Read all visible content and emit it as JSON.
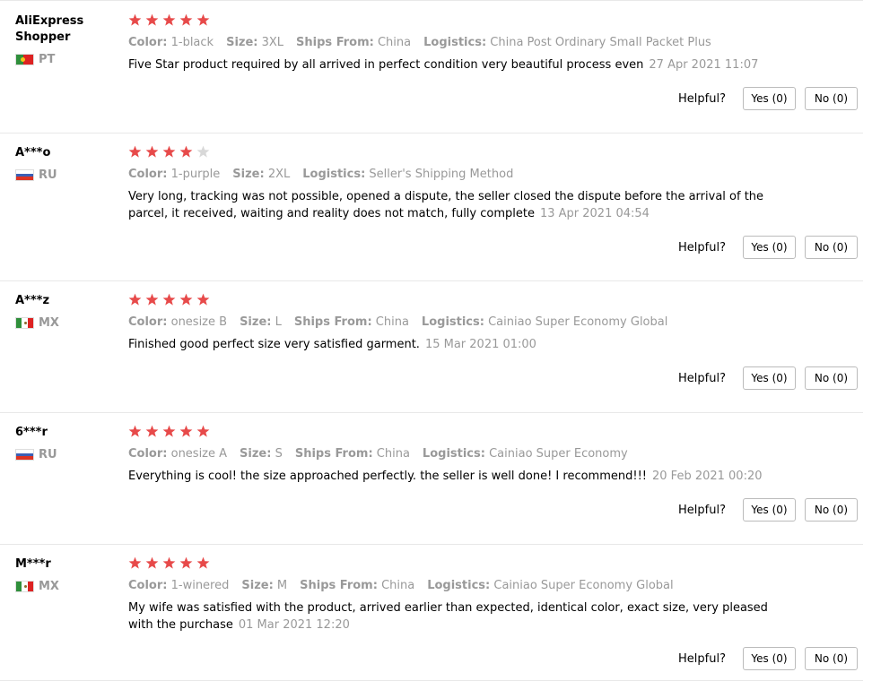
{
  "reviews": [
    {
      "user": "AliExpress Shopper",
      "country": "PT",
      "flag": "pt",
      "rating": 5,
      "attributes": [
        {
          "label": "Color:",
          "value": "1-black"
        },
        {
          "label": "Size:",
          "value": "3XL"
        },
        {
          "label": "Ships From:",
          "value": "China"
        },
        {
          "label": "Logistics:",
          "value": "China Post Ordinary Small Packet Plus"
        }
      ],
      "text": "Five Star product required by all arrived in perfect condition very beautiful process even",
      "date": "27 Apr 2021 11:07",
      "helpful_label": "Helpful?",
      "yes_label": "Yes (0)",
      "no_label": "No (0)"
    },
    {
      "user": "A***o",
      "country": "RU",
      "flag": "ru",
      "rating": 4,
      "attributes": [
        {
          "label": "Color:",
          "value": "1-purple"
        },
        {
          "label": "Size:",
          "value": "2XL"
        },
        {
          "label": "Logistics:",
          "value": "Seller's Shipping Method"
        }
      ],
      "text": "Very long, tracking was not possible, opened a dispute, the seller closed the dispute before the arrival of the parcel, it received, waiting and reality does not match, fully complete",
      "date": "13 Apr 2021 04:54",
      "helpful_label": "Helpful?",
      "yes_label": "Yes (0)",
      "no_label": "No (0)"
    },
    {
      "user": "A***z",
      "country": "MX",
      "flag": "mx",
      "rating": 5,
      "attributes": [
        {
          "label": "Color:",
          "value": "onesize B"
        },
        {
          "label": "Size:",
          "value": "L"
        },
        {
          "label": "Ships From:",
          "value": "China"
        },
        {
          "label": "Logistics:",
          "value": "Cainiao Super Economy Global"
        }
      ],
      "text": "Finished good perfect size very satisfied garment.",
      "date": "15 Mar 2021 01:00",
      "helpful_label": "Helpful?",
      "yes_label": "Yes (0)",
      "no_label": "No (0)"
    },
    {
      "user": "6***r",
      "country": "RU",
      "flag": "ru",
      "rating": 5,
      "attributes": [
        {
          "label": "Color:",
          "value": "onesize A"
        },
        {
          "label": "Size:",
          "value": "S"
        },
        {
          "label": "Ships From:",
          "value": "China"
        },
        {
          "label": "Logistics:",
          "value": "Cainiao Super Economy"
        }
      ],
      "text": "Everything is cool! the size approached perfectly. the seller is well done! I recommend!!!",
      "date": "20 Feb 2021 00:20",
      "helpful_label": "Helpful?",
      "yes_label": "Yes (0)",
      "no_label": "No (0)"
    },
    {
      "user": "M***r",
      "country": "MX",
      "flag": "mx",
      "rating": 5,
      "attributes": [
        {
          "label": "Color:",
          "value": "1-winered"
        },
        {
          "label": "Size:",
          "value": "M"
        },
        {
          "label": "Ships From:",
          "value": "China"
        },
        {
          "label": "Logistics:",
          "value": "Cainiao Super Economy Global"
        }
      ],
      "text": "My wife was satisfied with the product, arrived earlier than expected, identical color, exact size, very pleased with the purchase",
      "date": "01 Mar 2021 12:20",
      "helpful_label": "Helpful?",
      "yes_label": "Yes (0)",
      "no_label": "No (0)"
    }
  ],
  "colors": {
    "star_filled": "#e74a4a",
    "star_empty": "#d8d8d8",
    "muted_text": "#999999"
  }
}
